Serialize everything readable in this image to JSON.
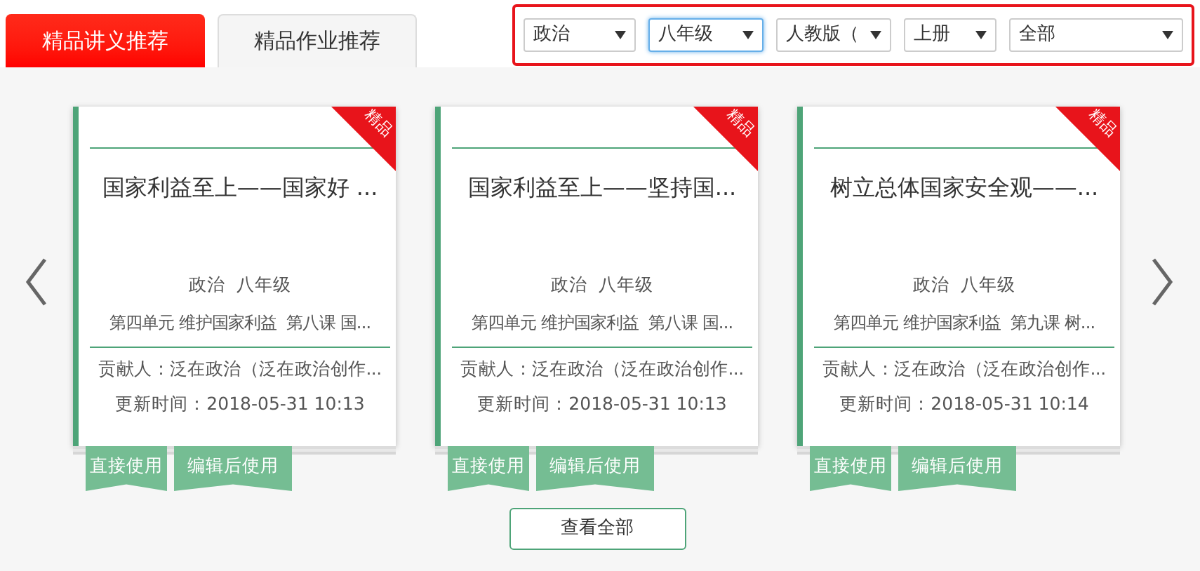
{
  "tabs": [
    {
      "label": "精品讲义推荐",
      "selected": true
    },
    {
      "label": "精品作业推荐",
      "selected": false
    }
  ],
  "filters": [
    {
      "value": "政治",
      "focused": false
    },
    {
      "value": "八年级",
      "focused": true
    },
    {
      "value": "人教版（",
      "focused": false
    },
    {
      "value": "上册",
      "focused": false
    },
    {
      "value": "全部",
      "focused": false
    }
  ],
  "cards": [
    {
      "badge": "精品",
      "title": "国家利益至上——国家好 ...",
      "subject": "政治  八年级",
      "chapter": "第四单元 维护国家利益  第八课 国...",
      "contributor": "贡献人：泛在政治（泛在政治创作...",
      "updated": "更新时间：2018-05-31 10:13",
      "actions": [
        "直接使用",
        "编辑后使用"
      ]
    },
    {
      "badge": "精品",
      "title": "国家利益至上——坚持国...",
      "subject": "政治  八年级",
      "chapter": "第四单元 维护国家利益  第八课 国...",
      "contributor": "贡献人：泛在政治（泛在政治创作...",
      "updated": "更新时间：2018-05-31 10:13",
      "actions": [
        "直接使用",
        "编辑后使用"
      ]
    },
    {
      "badge": "精品",
      "title": "树立总体国家安全观——...",
      "subject": "政治  八年级",
      "chapter": "第四单元 维护国家利益  第九课 树...",
      "contributor": "贡献人：泛在政治（泛在政治创作...",
      "updated": "更新时间：2018-05-31 10:14",
      "actions": [
        "直接使用",
        "编辑后使用"
      ]
    }
  ],
  "view_all": "查看全部"
}
